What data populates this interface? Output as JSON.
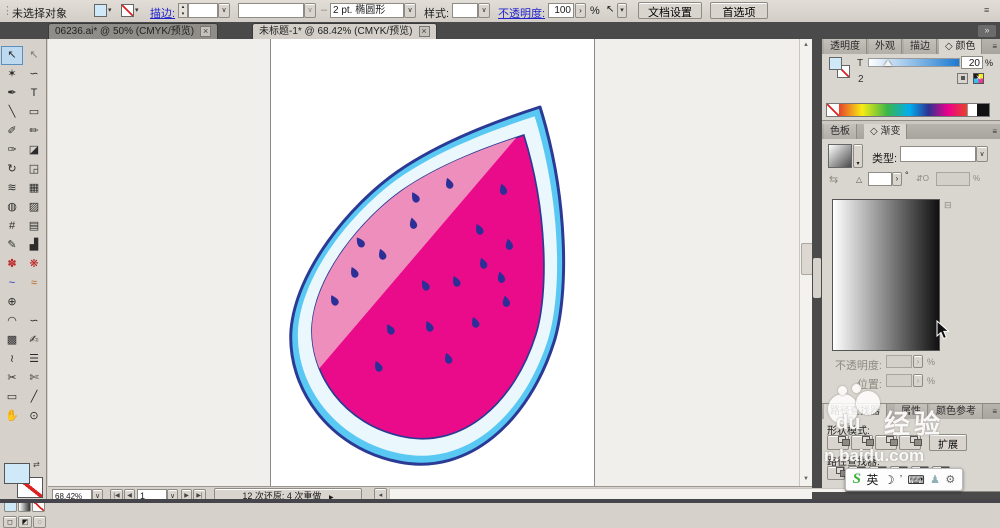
{
  "icons": {
    "grip": "⋮",
    "chevron": "▾",
    "chevron_v": "∨",
    "menu": "≡",
    "collapse": "»",
    "up": "▴",
    "down": "▾",
    "spin": "›",
    "swap": "⇄",
    "prev": "◀",
    "next": "▶",
    "first": "|◀",
    "last": "▶|",
    "scroll_left": "◂",
    "scroll_up": "▲",
    "scroll_down": "▼",
    "more": "▶",
    "close": "×",
    "degree": "°",
    "angle": "△",
    "reverse": "⇆",
    "aspect": "⇵O",
    "trash": "⊟",
    "dash": "–",
    "pointer": "↖",
    "moon": "☽",
    "keyboard": "⌨",
    "person": "♟",
    "wrench": "⚙",
    "quote": "’",
    "sogou": "S"
  },
  "control_bar": {
    "no_selection": "未选择对象",
    "stroke_link": "描边:",
    "brush_name": "2 pt. 椭圆形",
    "style_label": "样式:",
    "opacity_link": "不透明度:",
    "opacity_value": "100",
    "percent": "%",
    "doc_setup": "文档设置",
    "preferences": "首选项"
  },
  "doc_tabs": {
    "tab1": "06236.ai* @ 50% (CMYK/预览)",
    "tab2": "未标题-1* @ 68.42% (CMYK/预览)"
  },
  "toolbox": {
    "tools": [
      {
        "g": "↖",
        "name": "selection-tool",
        "a": true
      },
      {
        "g": "↖",
        "name": "direct-selection-tool",
        "c": "#7d7d7d"
      },
      {
        "g": "✶",
        "name": "magic-wand-tool"
      },
      {
        "g": "∽",
        "name": "lasso-tool"
      },
      {
        "g": "✒",
        "name": "pen-tool"
      },
      {
        "g": "T",
        "name": "type-tool"
      },
      {
        "g": "╲",
        "name": "line-segment-tool"
      },
      {
        "g": "▭",
        "name": "rectangle-tool"
      },
      {
        "g": "✐",
        "name": "paintbrush-tool"
      },
      {
        "g": "✏",
        "name": "pencil-tool"
      },
      {
        "g": "✑",
        "name": "blob-brush-tool"
      },
      {
        "g": "◪",
        "name": "eraser-tool"
      },
      {
        "g": "↻",
        "name": "rotate-tool"
      },
      {
        "g": "◲",
        "name": "scale-tool"
      },
      {
        "g": "≋",
        "name": "width-tool"
      },
      {
        "g": "▦",
        "name": "free-transform-tool"
      },
      {
        "g": "◍",
        "name": "shape-builder-tool"
      },
      {
        "g": "▨",
        "name": "live-paint-bucket-tool"
      },
      {
        "g": "#",
        "name": "mesh-tool"
      },
      {
        "g": "▤",
        "name": "gradient-tool"
      },
      {
        "g": "✎",
        "name": "eyedropper-tool"
      },
      {
        "g": "▟",
        "name": "column-graph-tool"
      },
      {
        "g": "✽",
        "name": "symbol-sprayer-tool",
        "c": "#bb2222"
      },
      {
        "g": "❋",
        "name": "symbol-stainer-tool",
        "c": "#bb2222"
      },
      {
        "g": "~",
        "name": "arc-tool",
        "c": "#2233bb"
      },
      {
        "g": "≈",
        "name": "warp-tool",
        "c": "#bb6622"
      },
      {
        "g": "⊕",
        "name": "perspective-grid-tool"
      },
      {
        "g": "",
        "name": "empty-tool-slot",
        "inert": true
      },
      {
        "g": "◠",
        "name": "reshape-tool"
      },
      {
        "g": "∽",
        "name": "wrinkle-tool"
      },
      {
        "g": "▩",
        "name": "live-paint-selection-tool"
      },
      {
        "g": "✍",
        "name": "freeform-tool"
      },
      {
        "g": "≀",
        "name": "scribble-tool"
      },
      {
        "g": "☰",
        "name": "list-tool"
      },
      {
        "g": "✂",
        "name": "scissors-tool"
      },
      {
        "g": "✄",
        "name": "knife-tool"
      },
      {
        "g": "▭",
        "name": "artboard-tool"
      },
      {
        "g": "╱",
        "name": "slice-tool"
      },
      {
        "g": "✋",
        "name": "hand-tool"
      },
      {
        "g": "⊙",
        "name": "zoom-tool"
      }
    ]
  },
  "canvas": {
    "artwork": {
      "label": "watermelon slice illustration",
      "colors": {
        "outline": "#2b3a94",
        "rind": "#59c9f4",
        "rind_pale": "#eaf7fd",
        "flesh_light": "#ee8ebd",
        "flesh_dark": "#ea0b8b",
        "seed": "#2b2f96"
      },
      "seeds_light": [
        [
          178,
          144,
          -20
        ],
        [
          144,
          158,
          -30
        ],
        [
          142,
          184,
          -15
        ],
        [
          89,
          203,
          -35
        ],
        [
          111,
          215,
          -20
        ],
        [
          83,
          233,
          -25
        ],
        [
          63,
          261,
          -30
        ]
      ],
      "seeds_dark": [
        [
          232,
          150,
          -15
        ],
        [
          208,
          190,
          -25
        ],
        [
          238,
          205,
          -10
        ],
        [
          212,
          224,
          -20
        ],
        [
          230,
          238,
          -15
        ],
        [
          185,
          242,
          -25
        ],
        [
          154,
          246,
          -30
        ],
        [
          235,
          262,
          -10
        ],
        [
          204,
          283,
          -20
        ],
        [
          158,
          287,
          -25
        ],
        [
          119,
          290,
          -30
        ],
        [
          177,
          319,
          -20
        ],
        [
          107,
          327,
          -25
        ]
      ]
    }
  },
  "right_dock": {
    "color_panel": {
      "tab_transparency": "透明度",
      "tab_appearance": "外观",
      "tab_stroke": "描边",
      "tab_color": "◇ 颜色",
      "tint_label": "T",
      "tint_value": "20",
      "percent": "%",
      "weight_value": "2"
    },
    "gradient_panel": {
      "tab_swatches": "色板",
      "tab_gradient": "◇ 渐变",
      "type_label": "类型:",
      "opacity_label": "不透明度:",
      "location_label": "位置:",
      "percent": "%"
    },
    "pathfinder_panel": {
      "tab_pathfinder": "路径查找器",
      "tab_attributes": "属性",
      "tab_color_guide": "颜色参考",
      "shape_modes_label": "形状模式:",
      "expand_button": "扩展",
      "pathfinder_label": "路径查找器:"
    }
  },
  "status_bar": {
    "zoom": "68.42%",
    "artboard": "1",
    "history": "12 次还原: 4 次重做"
  },
  "watermark": {
    "du": "du",
    "jingyan": "经验",
    "domain": "n.baidu.com"
  },
  "ime": {
    "lang": "英"
  }
}
